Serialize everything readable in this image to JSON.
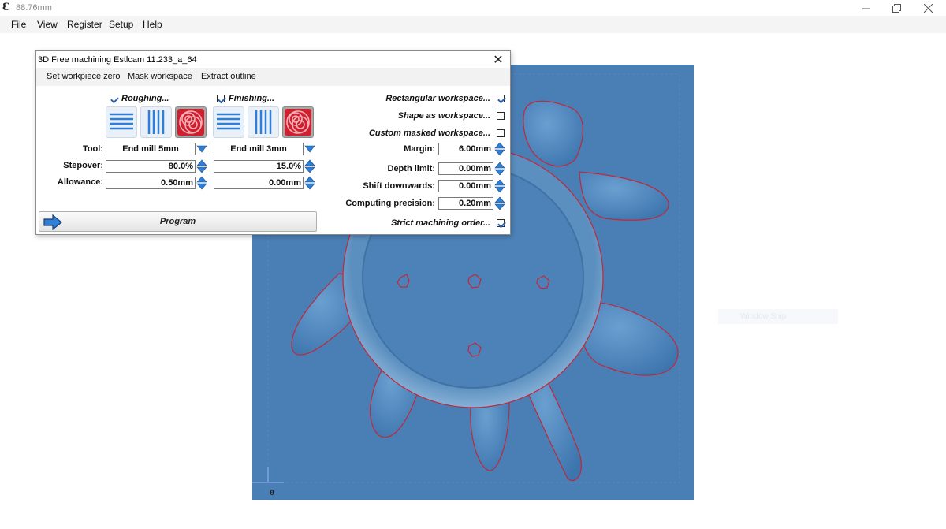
{
  "window": {
    "title": "88.76mm",
    "app_icon_glyph": "Ɛ"
  },
  "menubar": [
    "File",
    "View",
    "Register",
    "Setup",
    "Help"
  ],
  "ghost_window": {
    "label": "Window Snip"
  },
  "viewport": {
    "origin_label": "0",
    "background_color": "#4a7fb5",
    "outline_color": "#c0283a"
  },
  "dialog": {
    "title": "3D Free machining Estlcam 11.233_a_64",
    "menu": [
      "Set workpiece zero",
      "Mask workspace",
      "Extract outline"
    ],
    "roughing": {
      "label": "Roughing...",
      "enabled": true,
      "tool": "End mill 5mm",
      "stepover": "80.0%",
      "allowance": "0.50mm",
      "selected_strategy": "spiral"
    },
    "finishing": {
      "label": "Finishing...",
      "enabled": true,
      "tool": "End mill 3mm",
      "stepover": "15.0%",
      "allowance": "0.00mm",
      "selected_strategy": "spiral"
    },
    "row_labels": {
      "tool": "Tool:",
      "stepover": "Stepover:",
      "allowance": "Allowance:"
    },
    "workspace": {
      "rectangular": {
        "label": "Rectangular workspace...",
        "checked": true
      },
      "shape": {
        "label": "Shape as workspace...",
        "checked": false
      },
      "custom_masked": {
        "label": "Custom masked workspace...",
        "checked": false
      },
      "margin": {
        "label": "Margin:",
        "value": "6.00mm"
      },
      "depth_limit": {
        "label": "Depth limit:",
        "value": "0.00mm"
      },
      "shift_downwards": {
        "label": "Shift downwards:",
        "value": "0.00mm"
      },
      "computing_precision": {
        "label": "Computing precision:",
        "value": "0.20mm"
      },
      "strict_order": {
        "label": "Strict machining order...",
        "checked": true
      }
    },
    "program_button": "Program"
  }
}
